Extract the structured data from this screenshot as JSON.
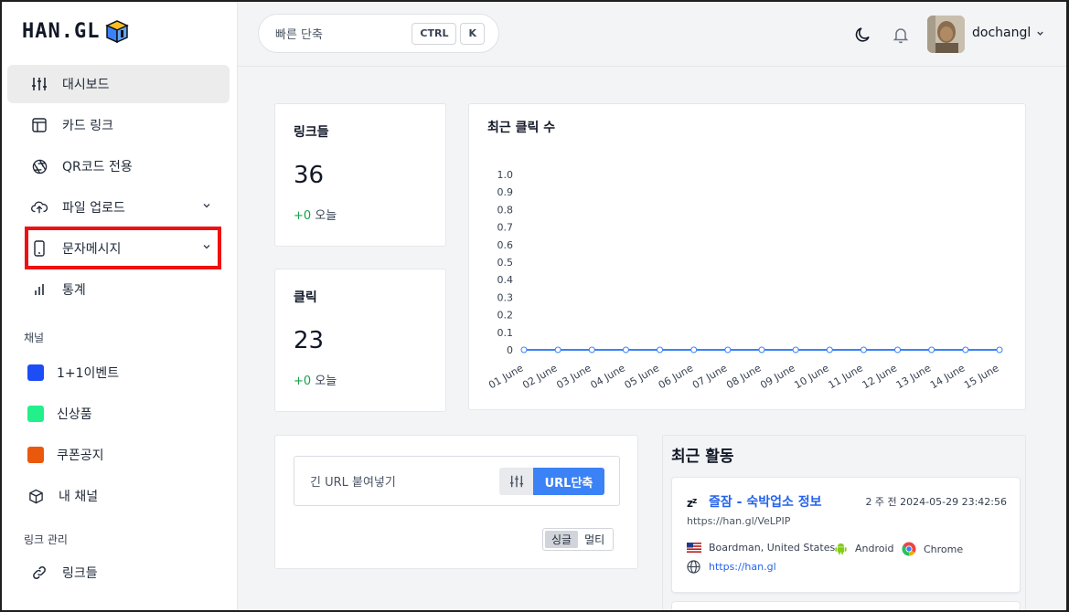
{
  "brand": {
    "logo_text": "HAN.GL"
  },
  "sidebar": {
    "items": [
      {
        "label": "대시보드",
        "icon": "sliders-icon"
      },
      {
        "label": "카드 링크",
        "icon": "layout-icon"
      },
      {
        "label": "QR코드 전용",
        "icon": "aperture-icon"
      },
      {
        "label": "파일 업로드",
        "icon": "upload-cloud-icon"
      },
      {
        "label": "문자메시지",
        "icon": "smartphone-icon"
      },
      {
        "label": "통계",
        "icon": "bar-chart-icon"
      }
    ],
    "channels_label": "채널",
    "channels": [
      {
        "label": "1+1이벤트",
        "color": "#1d4ef5"
      },
      {
        "label": "신상품",
        "color": "#22f08a"
      },
      {
        "label": "쿠폰공지",
        "color": "#ea580c"
      },
      {
        "label": "내 채널",
        "icon": "box-icon"
      }
    ],
    "links_label": "링크 관리",
    "links": [
      {
        "label": "링크들",
        "icon": "link-icon"
      }
    ]
  },
  "topbar": {
    "search_placeholder": "빠른 단축",
    "shortcut_ctrl": "CTRL",
    "shortcut_k": "K",
    "username": "dochangl"
  },
  "stats": {
    "links": {
      "title": "링크들",
      "value": "36",
      "delta": "+0",
      "delta_label": "오늘"
    },
    "clicks": {
      "title": "클릭",
      "value": "23",
      "delta": "+0",
      "delta_label": "오늘"
    }
  },
  "chart_data": {
    "type": "line",
    "title": "최근 클릭 수",
    "x": [
      "01 June",
      "02 June",
      "03 June",
      "04 June",
      "05 June",
      "06 June",
      "07 June",
      "08 June",
      "09 June",
      "10 June",
      "11 June",
      "12 June",
      "13 June",
      "14 June",
      "15 June"
    ],
    "series": [
      {
        "values": [
          0,
          0,
          0,
          0,
          0,
          0,
          0,
          0,
          0,
          0,
          0,
          0,
          0,
          0,
          0
        ]
      }
    ],
    "ylim": [
      0,
      1.0
    ],
    "yticks": [
      "0",
      "0.1",
      "0.2",
      "0.3",
      "0.4",
      "0.5",
      "0.6",
      "0.7",
      "0.8",
      "0.9",
      "1.0"
    ],
    "grid": false,
    "color": "#3b82f6"
  },
  "shortener": {
    "placeholder": "긴 URL 붙여넣기",
    "button": "URL단축",
    "mode_single": "싱글",
    "mode_multi": "멀티"
  },
  "activity": {
    "title": "최근 활동",
    "items": [
      {
        "title": "즐잠 - 숙박업소 정보",
        "time": "2 주 전 2024-05-29 23:42:56",
        "short_url": "https://han.gl/VeLPIP",
        "location": "Boardman, United States",
        "os": "Android",
        "browser": "Chrome",
        "referrer": "https://han.gl"
      }
    ]
  }
}
